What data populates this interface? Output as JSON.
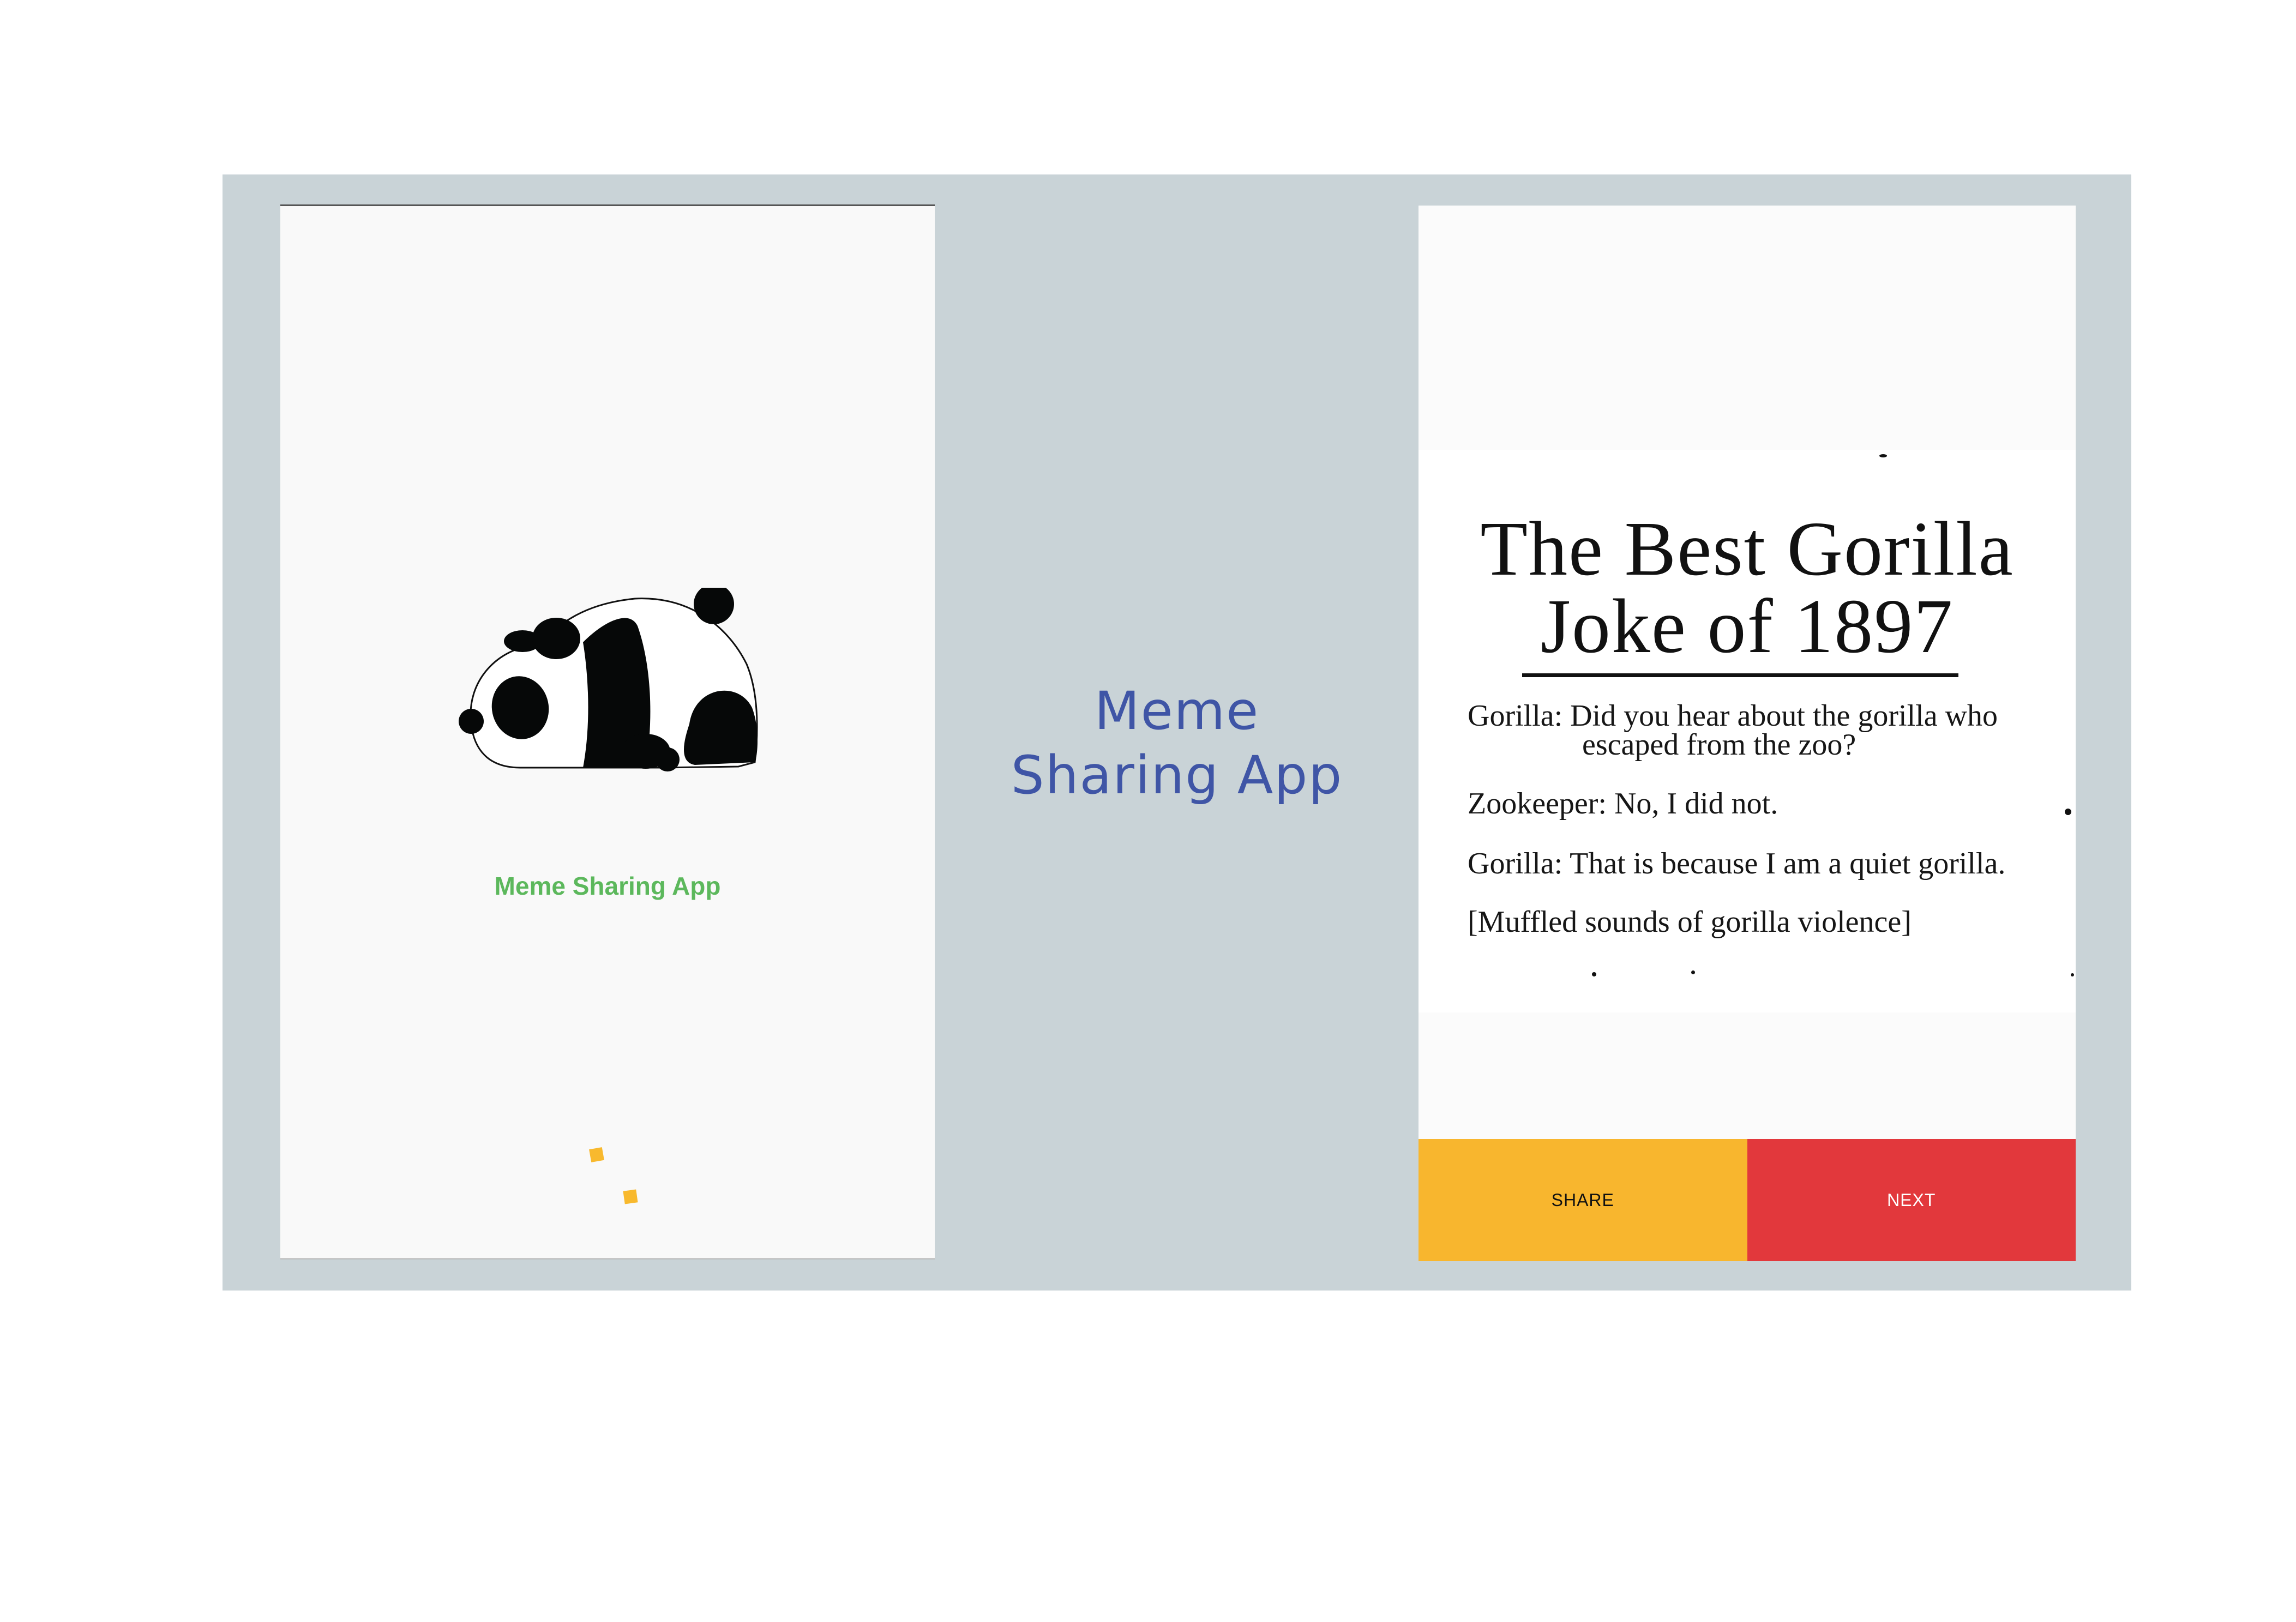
{
  "splash": {
    "title": "Meme Sharing App",
    "title_color": "#5cb85c",
    "loader_color": "#f8b92e",
    "logo_icon": "sleeping-panda"
  },
  "caption": {
    "line1": "Meme",
    "line2": "Sharing App",
    "color": "#3f55a6"
  },
  "meme": {
    "headline_line1": "The  Best  Gorilla",
    "headline_line2": "Joke  of  1897",
    "lines": [
      "Gorilla: Did you hear about the gorilla who",
      "escaped from the zoo?",
      "Zookeeper: No, I did not.",
      "Gorilla: That is because I am a quiet gorilla.",
      "[Muffled sounds of gorilla violence]"
    ]
  },
  "actions": {
    "share_label": "SHARE",
    "next_label": "NEXT",
    "share_color": "#f8b62e",
    "next_color": "#e2383c"
  }
}
